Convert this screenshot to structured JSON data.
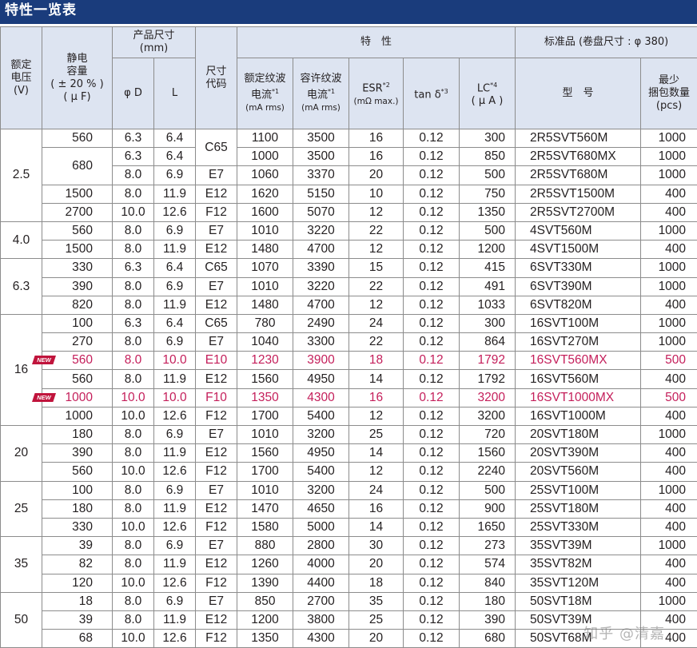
{
  "title": "特性一览表",
  "headers": {
    "rated_voltage": [
      "额定",
      "电压",
      "(V)"
    ],
    "capacitance": [
      "静电",
      "容量",
      "( ± 20 % )",
      "( μ F)"
    ],
    "dimensions": [
      "产品尺寸",
      "(mm)"
    ],
    "phi_d": "φ D",
    "l": "L",
    "size_code": [
      "尺寸",
      "代码"
    ],
    "characteristics": "特　性",
    "rated_ripple": [
      "额定纹波",
      "电流",
      "*1",
      "(mA rms)"
    ],
    "allow_ripple": [
      "容许纹波",
      "电流",
      "*1",
      "(mA rms)"
    ],
    "esr": [
      "ESR",
      "*2",
      "(mΩ max.)"
    ],
    "tan": [
      "tan δ",
      "*3"
    ],
    "lc": [
      "LC",
      "*4",
      "( μ A )"
    ],
    "standard": "标准品 (卷盘尺寸 : φ 380)",
    "model": "型　号",
    "min_pack": [
      "最少",
      "捆包数量",
      "(pcs)"
    ]
  },
  "groups": [
    {
      "voltage": "2.5",
      "rows": [
        {
          "cap": "560",
          "d": "6.3",
          "l": "6.4",
          "code": "C65",
          "rated": "1100",
          "allow": "3500",
          "esr": "16",
          "tan": "0.12",
          "lc": "300",
          "model": "2R5SVT560M",
          "pcs": "1000"
        },
        {
          "cap": "680",
          "d": "6.3",
          "l": "6.4",
          "code": "",
          "rated": "1000",
          "allow": "3500",
          "esr": "16",
          "tan": "0.12",
          "lc": "850",
          "model": "2R5SVT680MX",
          "pcs": "1000"
        },
        {
          "cap": "",
          "d": "8.0",
          "l": "6.9",
          "code": "E7",
          "rated": "1060",
          "allow": "3370",
          "esr": "20",
          "tan": "0.12",
          "lc": "500",
          "model": "2R5SVT680M",
          "pcs": "1000"
        },
        {
          "cap": "1500",
          "d": "8.0",
          "l": "11.9",
          "code": "E12",
          "rated": "1620",
          "allow": "5150",
          "esr": "10",
          "tan": "0.12",
          "lc": "750",
          "model": "2R5SVT1500M",
          "pcs": "400"
        },
        {
          "cap": "2700",
          "d": "10.0",
          "l": "12.6",
          "code": "F12",
          "rated": "1600",
          "allow": "5070",
          "esr": "12",
          "tan": "0.12",
          "lc": "1350",
          "model": "2R5SVT2700M",
          "pcs": "400"
        }
      ]
    },
    {
      "voltage": "4.0",
      "rows": [
        {
          "cap": "560",
          "d": "8.0",
          "l": "6.9",
          "code": "E7",
          "rated": "1010",
          "allow": "3220",
          "esr": "22",
          "tan": "0.12",
          "lc": "500",
          "model": "4SVT560M",
          "pcs": "1000"
        },
        {
          "cap": "1500",
          "d": "8.0",
          "l": "11.9",
          "code": "E12",
          "rated": "1480",
          "allow": "4700",
          "esr": "12",
          "tan": "0.12",
          "lc": "1200",
          "model": "4SVT1500M",
          "pcs": "400"
        }
      ]
    },
    {
      "voltage": "6.3",
      "rows": [
        {
          "cap": "330",
          "d": "6.3",
          "l": "6.4",
          "code": "C65",
          "rated": "1070",
          "allow": "3390",
          "esr": "15",
          "tan": "0.12",
          "lc": "415",
          "model": "6SVT330M",
          "pcs": "1000"
        },
        {
          "cap": "390",
          "d": "8.0",
          "l": "6.9",
          "code": "E7",
          "rated": "1010",
          "allow": "3220",
          "esr": "22",
          "tan": "0.12",
          "lc": "491",
          "model": "6SVT390M",
          "pcs": "1000"
        },
        {
          "cap": "820",
          "d": "8.0",
          "l": "11.9",
          "code": "E12",
          "rated": "1480",
          "allow": "4700",
          "esr": "12",
          "tan": "0.12",
          "lc": "1033",
          "model": "6SVT820M",
          "pcs": "400"
        }
      ]
    },
    {
      "voltage": "16",
      "rows": [
        {
          "cap": "100",
          "d": "6.3",
          "l": "6.4",
          "code": "C65",
          "rated": "780",
          "allow": "2490",
          "esr": "24",
          "tan": "0.12",
          "lc": "300",
          "model": "16SVT100M",
          "pcs": "1000"
        },
        {
          "cap": "270",
          "d": "8.0",
          "l": "6.9",
          "code": "E7",
          "rated": "1040",
          "allow": "3300",
          "esr": "22",
          "tan": "0.12",
          "lc": "864",
          "model": "16SVT270M",
          "pcs": "1000"
        },
        {
          "cap": "560",
          "d": "8.0",
          "l": "10.0",
          "code": "E10",
          "rated": "1230",
          "allow": "3900",
          "esr": "18",
          "tan": "0.12",
          "lc": "1792",
          "model": "16SVT560MX",
          "pcs": "500",
          "new": "NEW"
        },
        {
          "cap": "560",
          "d": "8.0",
          "l": "11.9",
          "code": "E12",
          "rated": "1560",
          "allow": "4950",
          "esr": "14",
          "tan": "0.12",
          "lc": "1792",
          "model": "16SVT560M",
          "pcs": "400"
        },
        {
          "cap": "1000",
          "d": "10.0",
          "l": "10.0",
          "code": "F10",
          "rated": "1350",
          "allow": "4300",
          "esr": "16",
          "tan": "0.12",
          "lc": "3200",
          "model": "16SVT1000MX",
          "pcs": "500",
          "new": "NEW"
        },
        {
          "cap": "1000",
          "d": "10.0",
          "l": "12.6",
          "code": "F12",
          "rated": "1700",
          "allow": "5400",
          "esr": "12",
          "tan": "0.12",
          "lc": "3200",
          "model": "16SVT1000M",
          "pcs": "400"
        }
      ]
    },
    {
      "voltage": "20",
      "rows": [
        {
          "cap": "180",
          "d": "8.0",
          "l": "6.9",
          "code": "E7",
          "rated": "1010",
          "allow": "3200",
          "esr": "25",
          "tan": "0.12",
          "lc": "720",
          "model": "20SVT180M",
          "pcs": "1000"
        },
        {
          "cap": "390",
          "d": "8.0",
          "l": "11.9",
          "code": "E12",
          "rated": "1560",
          "allow": "4950",
          "esr": "14",
          "tan": "0.12",
          "lc": "1560",
          "model": "20SVT390M",
          "pcs": "400"
        },
        {
          "cap": "560",
          "d": "10.0",
          "l": "12.6",
          "code": "F12",
          "rated": "1700",
          "allow": "5400",
          "esr": "12",
          "tan": "0.12",
          "lc": "2240",
          "model": "20SVT560M",
          "pcs": "400"
        }
      ]
    },
    {
      "voltage": "25",
      "rows": [
        {
          "cap": "100",
          "d": "8.0",
          "l": "6.9",
          "code": "E7",
          "rated": "1010",
          "allow": "3200",
          "esr": "24",
          "tan": "0.12",
          "lc": "500",
          "model": "25SVT100M",
          "pcs": "1000"
        },
        {
          "cap": "180",
          "d": "8.0",
          "l": "11.9",
          "code": "E12",
          "rated": "1470",
          "allow": "4650",
          "esr": "16",
          "tan": "0.12",
          "lc": "900",
          "model": "25SVT180M",
          "pcs": "400"
        },
        {
          "cap": "330",
          "d": "10.0",
          "l": "12.6",
          "code": "F12",
          "rated": "1580",
          "allow": "5000",
          "esr": "14",
          "tan": "0.12",
          "lc": "1650",
          "model": "25SVT330M",
          "pcs": "400"
        }
      ]
    },
    {
      "voltage": "35",
      "rows": [
        {
          "cap": "39",
          "d": "8.0",
          "l": "6.9",
          "code": "E7",
          "rated": "880",
          "allow": "2800",
          "esr": "30",
          "tan": "0.12",
          "lc": "273",
          "model": "35SVT39M",
          "pcs": "1000"
        },
        {
          "cap": "82",
          "d": "8.0",
          "l": "11.9",
          "code": "E12",
          "rated": "1260",
          "allow": "4000",
          "esr": "20",
          "tan": "0.12",
          "lc": "574",
          "model": "35SVT82M",
          "pcs": "400"
        },
        {
          "cap": "120",
          "d": "10.0",
          "l": "12.6",
          "code": "F12",
          "rated": "1390",
          "allow": "4400",
          "esr": "18",
          "tan": "0.12",
          "lc": "840",
          "model": "35SVT120M",
          "pcs": "400"
        }
      ]
    },
    {
      "voltage": "50",
      "rows": [
        {
          "cap": "18",
          "d": "8.0",
          "l": "6.9",
          "code": "E7",
          "rated": "850",
          "allow": "2700",
          "esr": "35",
          "tan": "0.12",
          "lc": "180",
          "model": "50SVT18M",
          "pcs": "1000"
        },
        {
          "cap": "39",
          "d": "8.0",
          "l": "11.9",
          "code": "E12",
          "rated": "1200",
          "allow": "3800",
          "esr": "25",
          "tan": "0.12",
          "lc": "390",
          "model": "50SVT39M",
          "pcs": "400"
        },
        {
          "cap": "68",
          "d": "10.0",
          "l": "12.6",
          "code": "F12",
          "rated": "1350",
          "allow": "4300",
          "esr": "20",
          "tan": "0.12",
          "lc": "680",
          "model": "50SVT68M",
          "pcs": "400"
        }
      ]
    }
  ],
  "watermark": "知乎 @清嘉"
}
